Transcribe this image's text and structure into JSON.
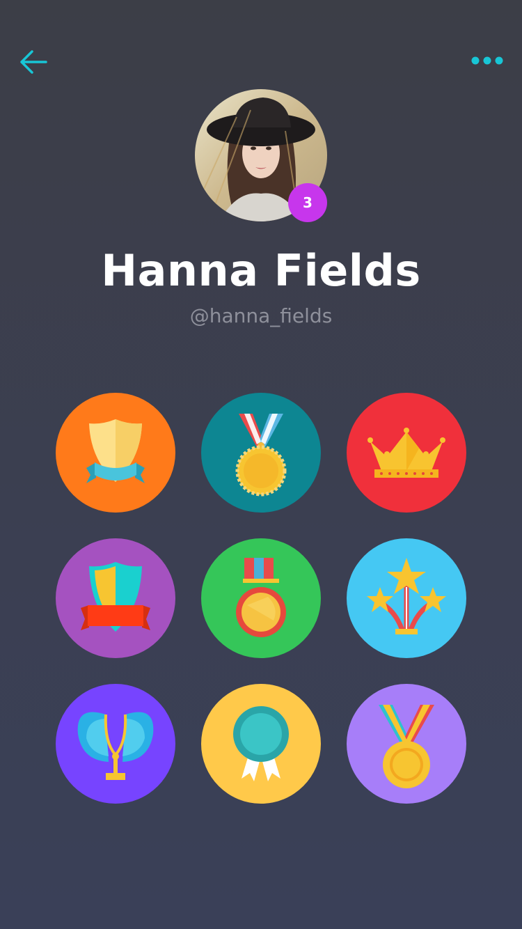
{
  "header": {
    "back_icon": "arrow-left-icon",
    "more_icon": "more-horizontal-icon",
    "accent_color": "#18c6d6"
  },
  "profile": {
    "name": "Hanna Fields",
    "handle": "@hanna_fields",
    "level_badge": "3",
    "badge_color": "#c736ec",
    "avatar_icon": "profile-photo"
  },
  "achievements": [
    {
      "icon": "shield-ribbon-icon",
      "bg": "#ff7a1a"
    },
    {
      "icon": "medal-icon",
      "bg": "#0d8692"
    },
    {
      "icon": "crown-icon",
      "bg": "#f0303b"
    },
    {
      "icon": "shield-banner-icon",
      "bg": "#a552c0"
    },
    {
      "icon": "medal-ribbon-icon",
      "bg": "#35c659"
    },
    {
      "icon": "stars-icon",
      "bg": "#45c8f3"
    },
    {
      "icon": "winged-trophy-icon",
      "bg": "#7744ff"
    },
    {
      "icon": "rosette-icon",
      "bg": "#ffc94a"
    },
    {
      "icon": "gold-medal-icon",
      "bg": "#a77ef9"
    }
  ]
}
